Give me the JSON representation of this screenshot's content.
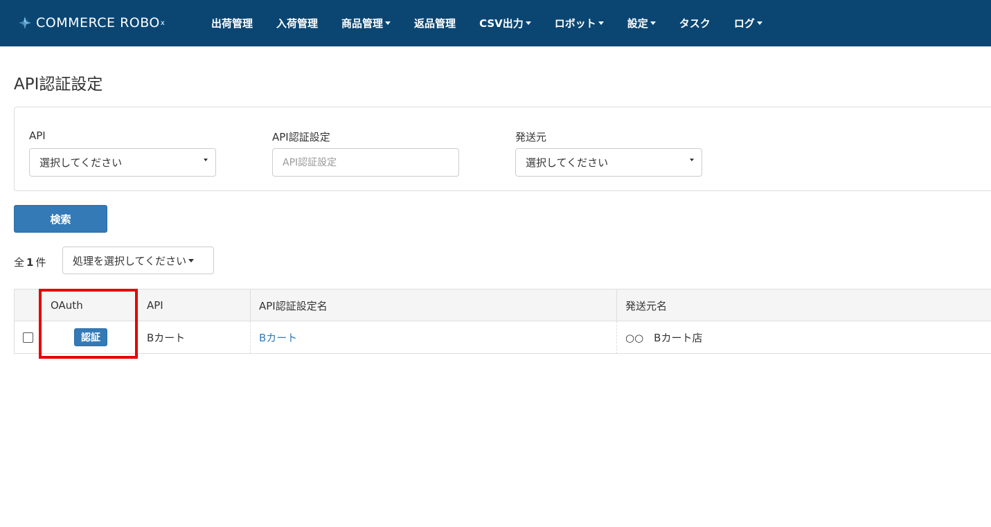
{
  "brand": {
    "name": "COMMERCE ROBO",
    "sup": "x"
  },
  "nav": {
    "items": [
      {
        "label": "出荷管理",
        "dropdown": false
      },
      {
        "label": "入荷管理",
        "dropdown": false
      },
      {
        "label": "商品管理",
        "dropdown": true
      },
      {
        "label": "返品管理",
        "dropdown": false
      },
      {
        "label": "CSV出力",
        "dropdown": true
      },
      {
        "label": "ロボット",
        "dropdown": true
      },
      {
        "label": "設定",
        "dropdown": true
      },
      {
        "label": "タスク",
        "dropdown": false
      },
      {
        "label": "ログ",
        "dropdown": true
      }
    ]
  },
  "page": {
    "title": "API認証設定"
  },
  "filters": {
    "api": {
      "label": "API",
      "value": "選択してください"
    },
    "auth_setting": {
      "label": "API認証設定",
      "placeholder": "API認証設定"
    },
    "sender": {
      "label": "発送元",
      "value": "選択してください"
    }
  },
  "actions": {
    "search_label": "検索",
    "count_prefix": "全",
    "count_value": "1",
    "count_suffix": "件",
    "bulk_action_label": "処理を選択してください"
  },
  "table": {
    "columns": {
      "oauth": "OAuth",
      "api": "API",
      "setting_name": "API認証設定名",
      "sender_name": "発送元名"
    },
    "rows": [
      {
        "auth_button": "認証",
        "api": "Bカート",
        "setting_name": "Bカート",
        "sender_name": "○○　Bカート店"
      }
    ]
  },
  "colors": {
    "navbar": "#0b4673",
    "primary": "#337ab7",
    "highlight": "#e60000"
  },
  "icons": [
    "commerce-robo-logo-icon",
    "caret-down-icon"
  ]
}
